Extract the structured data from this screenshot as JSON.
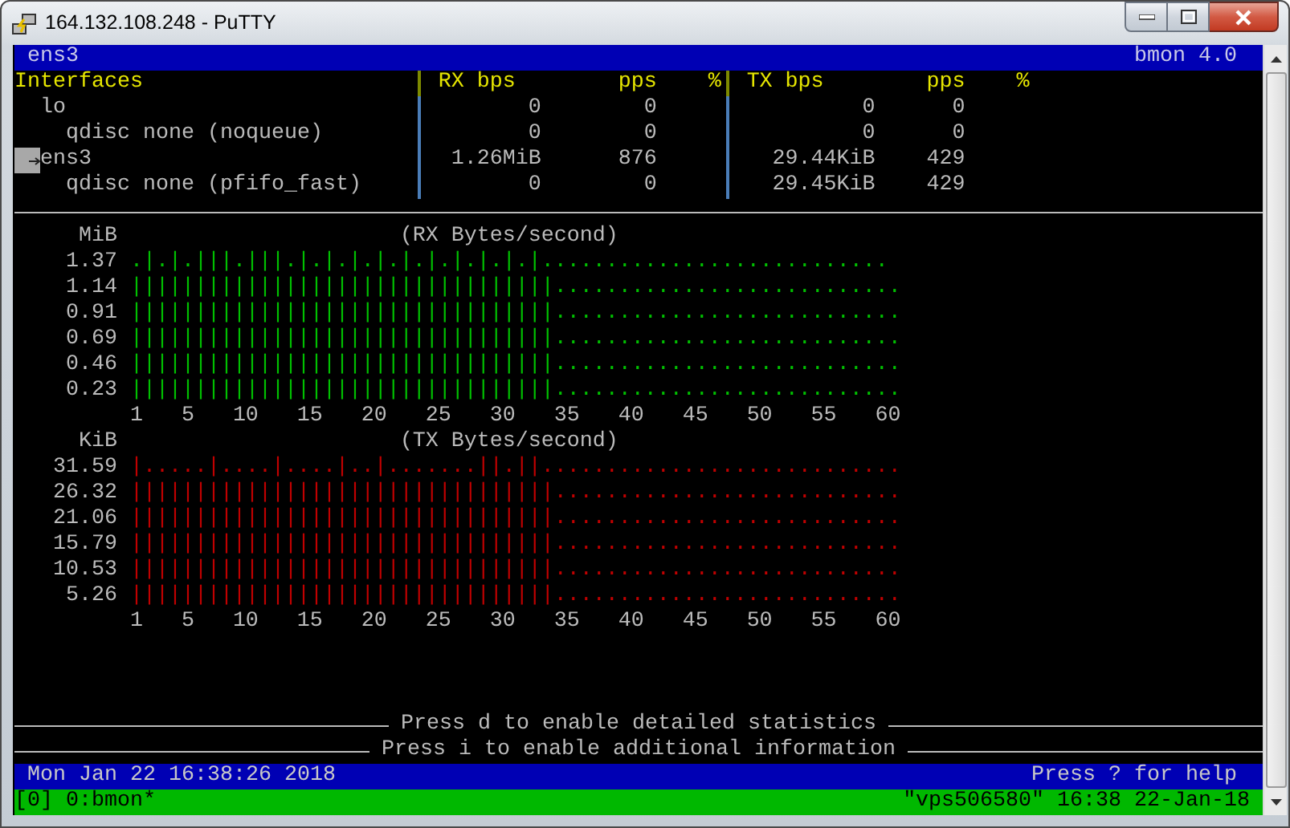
{
  "window": {
    "title": "164.132.108.248 - PuTTY"
  },
  "header_bar": {
    "left": "ens3",
    "right": "bmon 4.0"
  },
  "interfaces": {
    "columns": {
      "name": "Interfaces",
      "rx_bps": "RX bps",
      "rx_pps": "pps",
      "rx_pct": "%",
      "tx_bps": "TX bps",
      "tx_pps": "pps",
      "tx_pct": "%"
    },
    "items": [
      {
        "name": "lo",
        "selected": false,
        "rx_bps": "0",
        "rx_pps": "0",
        "tx_bps": "0",
        "tx_pps": "0",
        "children": [
          {
            "name": "qdisc none (noqueue)",
            "selected": false,
            "rx_bps": "0",
            "rx_pps": "0",
            "tx_bps": "0",
            "tx_pps": "0"
          }
        ]
      },
      {
        "name": "ens3",
        "selected": true,
        "rx_bps": "1.26MiB",
        "rx_pps": "876",
        "tx_bps": "29.44KiB",
        "tx_pps": "429",
        "children": [
          {
            "name": "qdisc none (pfifo_fast)",
            "selected": false,
            "rx_bps": "0",
            "rx_pps": "0",
            "tx_bps": "29.45KiB",
            "tx_pps": "429"
          }
        ]
      }
    ]
  },
  "graphs": [
    {
      "unit": "MiB",
      "title": "(RX Bytes/second)",
      "color": "#00c000",
      "rows": [
        {
          "label": "1.37",
          "bars": ".|.|.|||.|||.|.|.|.|.|.|.|.|.|.|..........................."
        },
        {
          "label": "1.14",
          "bars": "|||||||||||||||||||||||||||||||||..........................."
        },
        {
          "label": "0.91",
          "bars": "|||||||||||||||||||||||||||||||||..........................."
        },
        {
          "label": "0.69",
          "bars": "|||||||||||||||||||||||||||||||||..........................."
        },
        {
          "label": "0.46",
          "bars": "|||||||||||||||||||||||||||||||||..........................."
        },
        {
          "label": "0.23",
          "bars": "|||||||||||||||||||||||||||||||||..........................."
        }
      ],
      "x_ticks": [
        "1",
        "5",
        "10",
        "15",
        "20",
        "25",
        "30",
        "35",
        "40",
        "45",
        "50",
        "55",
        "60"
      ]
    },
    {
      "unit": "KiB",
      "title": "(TX Bytes/second)",
      "color": "#c00000",
      "rows": [
        {
          "label": "31.59",
          "bars": "|.....|....|....|..|.......||.||............................"
        },
        {
          "label": "26.32",
          "bars": "|||||||||||||||||||||||||||||||||..........................."
        },
        {
          "label": "21.06",
          "bars": "|||||||||||||||||||||||||||||||||..........................."
        },
        {
          "label": "15.79",
          "bars": "|||||||||||||||||||||||||||||||||..........................."
        },
        {
          "label": "10.53",
          "bars": "|||||||||||||||||||||||||||||||||..........................."
        },
        {
          "label": "5.26",
          "bars": "|||||||||||||||||||||||||||||||||..........................."
        }
      ],
      "x_ticks": [
        "1",
        "5",
        "10",
        "15",
        "20",
        "25",
        "30",
        "35",
        "40",
        "45",
        "50",
        "55",
        "60"
      ]
    }
  ],
  "hints": [
    "Press d to enable detailed statistics",
    "Press i to enable additional information"
  ],
  "status_bar": {
    "left": "Mon Jan 22 16:38:26 2018",
    "right": "Press ? for help"
  },
  "tmux_bar": {
    "left": "[0] 0:bmon*",
    "right": "\"vps506580\" 16:38 22-Jan-18"
  }
}
